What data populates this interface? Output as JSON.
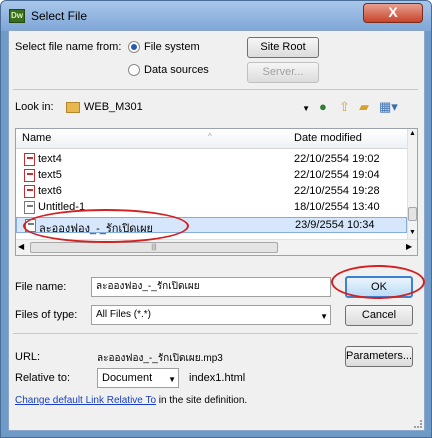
{
  "window": {
    "title": "Select File",
    "app_icon_text": "Dw",
    "close_label": "X"
  },
  "source": {
    "label": "Select file name from:",
    "option_file_system": "File system",
    "option_data_sources": "Data sources",
    "selected": "File system",
    "site_root_label": "Site Root",
    "server_label": "Server..."
  },
  "look_in": {
    "label": "Look in:",
    "value": "WEB_M301"
  },
  "file_list": {
    "columns": [
      "Name",
      "Date modified"
    ],
    "rows": [
      {
        "name": "text4",
        "date": "22/10/2554 19:02",
        "icon": "pdf-file-icon"
      },
      {
        "name": "text5",
        "date": "22/10/2554 19:04",
        "icon": "pdf-file-icon"
      },
      {
        "name": "text6",
        "date": "22/10/2554 19:28",
        "icon": "pdf-file-icon"
      },
      {
        "name": "Untitled-1",
        "date": "18/10/2554 13:40",
        "icon": "document-icon"
      },
      {
        "name": "ละอองฟอง_-_รักเปิดเผย",
        "date": "23/9/2554 10:34",
        "icon": "audio-file-icon",
        "selected": true
      }
    ],
    "hscroll_grip": "|||"
  },
  "file_name": {
    "label": "File name:",
    "value": "ละอองฟอง_-_รักเปิดเผย",
    "ok_label": "OK"
  },
  "files_of_type": {
    "label": "Files of type:",
    "value": "All Files (*.*)",
    "cancel_label": "Cancel"
  },
  "url": {
    "label": "URL:",
    "value": "ละอองฟอง_-_รักเปิดเผย.mp3",
    "parameters_label": "Parameters..."
  },
  "relative_to": {
    "label": "Relative to:",
    "value": "Document",
    "target": "index1.html"
  },
  "footer": {
    "link_text": "Change default Link Relative To",
    "rest_text": " in the site definition."
  },
  "colors": {
    "annotation_red": "#d42020",
    "selection_blue": "#d6e7fb",
    "link_blue": "#1a3fc6"
  }
}
